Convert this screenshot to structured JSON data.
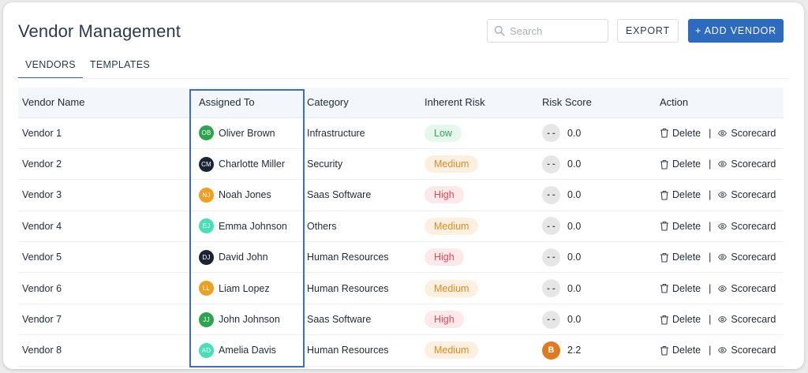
{
  "header": {
    "title": "Vendor Management",
    "search_placeholder": "Search",
    "export_label": "EXPORT",
    "add_vendor_label": "+ ADD VENDOR"
  },
  "tabs": [
    {
      "label": "VENDORS",
      "active": true
    },
    {
      "label": "TEMPLATES",
      "active": false
    }
  ],
  "table": {
    "columns": [
      "Vendor Name",
      "Assigned To",
      "Category",
      "Inherent Risk",
      "Risk Score",
      "Action"
    ],
    "rows": [
      {
        "vendor": "Vendor 1",
        "initials": "OB",
        "assignee": "Oliver Brown",
        "avatar_color": "#2da44e",
        "category": "Infrastructure",
        "risk": "Low",
        "score_badge": "- -",
        "score": "0.0",
        "delete": "Delete",
        "scorecard": "Scorecard"
      },
      {
        "vendor": "Vendor 2",
        "initials": "CM",
        "assignee": "Charlotte Miller",
        "avatar_color": "#1b2433",
        "category": "Security",
        "risk": "Medium",
        "score_badge": "- -",
        "score": "0.0",
        "delete": "Delete",
        "scorecard": "Scorecard"
      },
      {
        "vendor": "Vendor 3",
        "initials": "NJ",
        "assignee": "Noah Jones",
        "avatar_color": "#f0a020",
        "category": "Saas Software",
        "risk": "High",
        "score_badge": "- -",
        "score": "0.0",
        "delete": "Delete",
        "scorecard": "Scorecard"
      },
      {
        "vendor": "Vendor 4",
        "initials": "EJ",
        "assignee": "Emma Johnson",
        "avatar_color": "#46e0b6",
        "category": "Others",
        "risk": "Medium",
        "score_badge": "- -",
        "score": "0.0",
        "delete": "Delete",
        "scorecard": "Scorecard"
      },
      {
        "vendor": "Vendor 5",
        "initials": "DJ",
        "assignee": "David John",
        "avatar_color": "#1b2433",
        "category": "Human Resources",
        "risk": "High",
        "score_badge": "- -",
        "score": "0.0",
        "delete": "Delete",
        "scorecard": "Scorecard"
      },
      {
        "vendor": "Vendor 6",
        "initials": "LL",
        "assignee": "Liam Lopez",
        "avatar_color": "#f0a020",
        "category": "Human Resources",
        "risk": "Medium",
        "score_badge": "- -",
        "score": "0.0",
        "delete": "Delete",
        "scorecard": "Scorecard"
      },
      {
        "vendor": "Vendor 7",
        "initials": "JJ",
        "assignee": "John Johnson",
        "avatar_color": "#2da44e",
        "category": "Saas Software",
        "risk": "High",
        "score_badge": "- -",
        "score": "0.0",
        "delete": "Delete",
        "scorecard": "Scorecard"
      },
      {
        "vendor": "Vendor 8",
        "initials": "AD",
        "assignee": "Amelia Davis",
        "avatar_color": "#46e0b6",
        "category": "Human Resources",
        "risk": "Medium",
        "score_badge": "B",
        "score": "2.2",
        "delete": "Delete",
        "scorecard": "Scorecard"
      }
    ]
  },
  "colors": {
    "accent": "#2e6bbf",
    "highlight_border": "#3f6fb3",
    "risk_low_bg": "#e6f7ec",
    "risk_low_text": "#2ea55a",
    "risk_medium_bg": "#fdf0e1",
    "risk_medium_text": "#e08a1e",
    "risk_high_bg": "#fde9ea",
    "risk_high_text": "#e04a55",
    "score_empty_bg": "#e6e6e6",
    "score_grade_bg": "#e07a1e"
  }
}
